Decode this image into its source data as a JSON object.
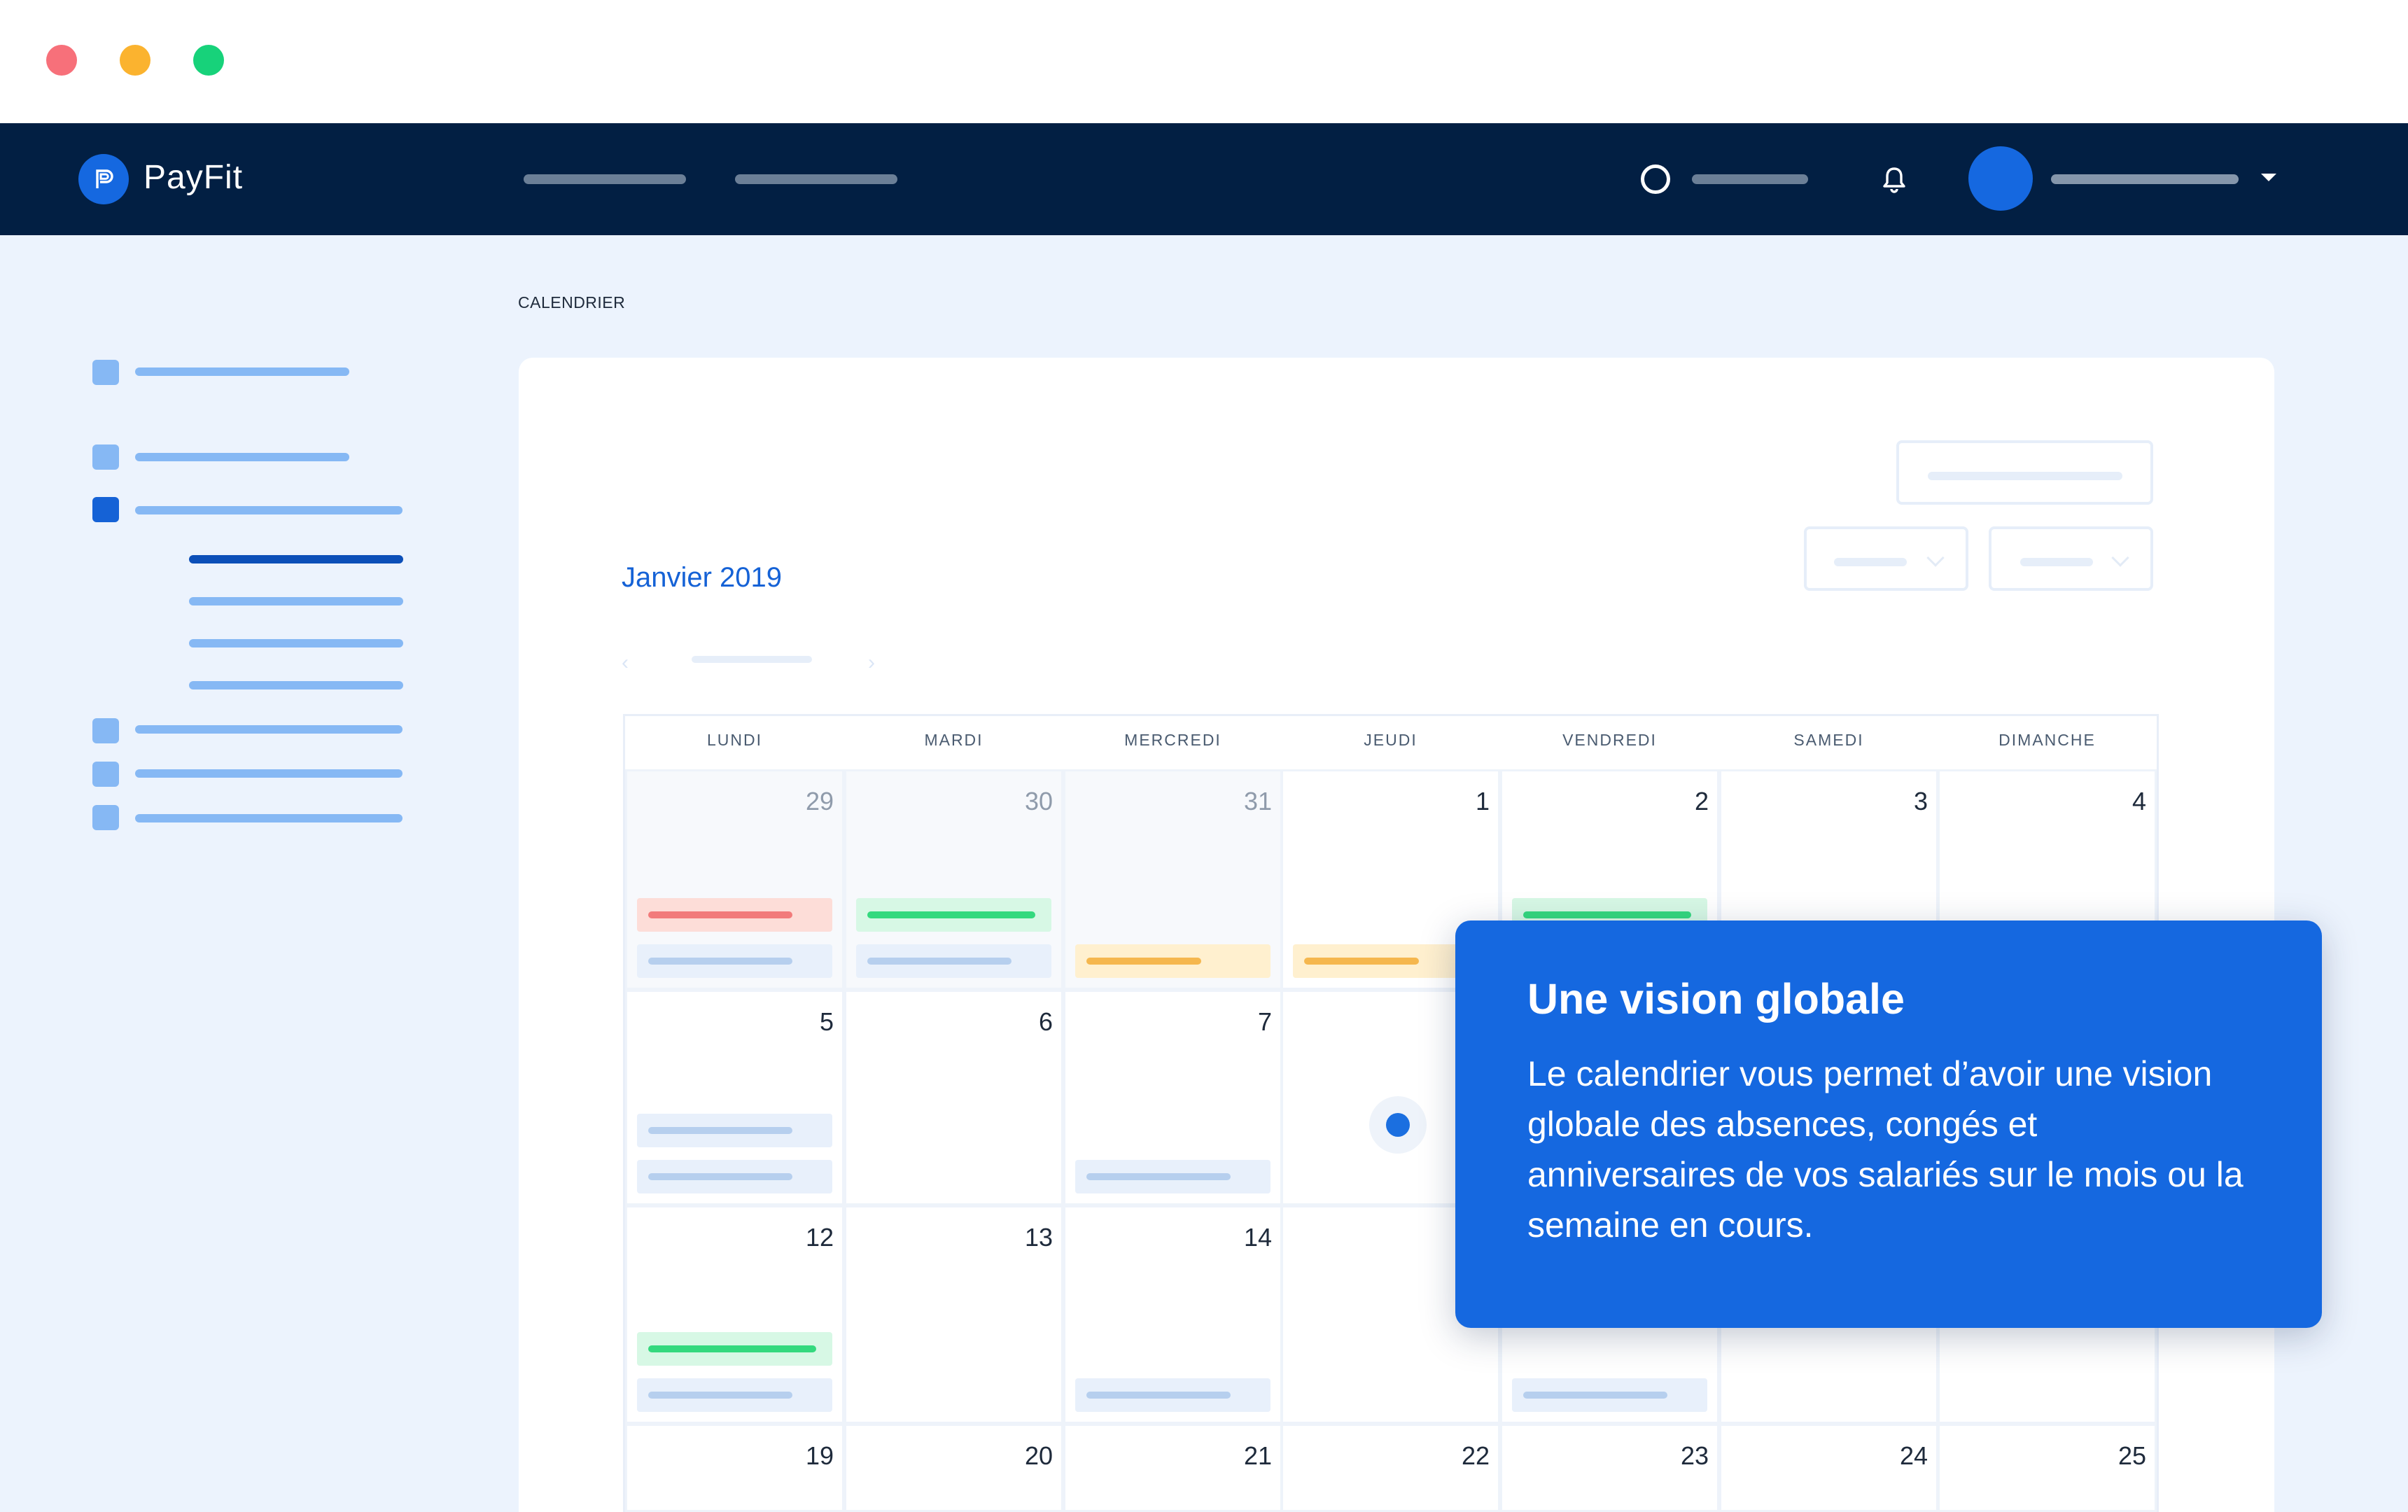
{
  "app": {
    "name": "PayFit",
    "colors": {
      "brand": "#1568e0",
      "nav_background": "#021f43",
      "page_background": "#ecf3fd"
    }
  },
  "window_controls": [
    {
      "name": "close",
      "color": "#f7707a"
    },
    {
      "name": "minimize",
      "color": "#fbb32f"
    },
    {
      "name": "maximize",
      "color": "#17d27a"
    }
  ],
  "breadcrumb": "CALENDRIER",
  "calendar": {
    "month_label": "Janvier 2019",
    "prev_icon": "chevron-left-icon",
    "next_icon": "chevron-right-icon",
    "weekdays": [
      "LUNDI",
      "MARDI",
      "MERCREDI",
      "JEUDI",
      "VENDREDI",
      "SAMEDI",
      "DIMANCHE"
    ],
    "weeks": [
      [
        {
          "day": "29",
          "outside_month": true,
          "events": [
            "red",
            "blue"
          ]
        },
        {
          "day": "30",
          "outside_month": true,
          "events": [
            "green",
            "blue"
          ]
        },
        {
          "day": "31",
          "outside_month": true,
          "events": [
            "yellow"
          ]
        },
        {
          "day": "1",
          "outside_month": false,
          "events": [
            "yellow"
          ]
        },
        {
          "day": "2",
          "outside_month": false,
          "events": [
            "green",
            "blue"
          ]
        },
        {
          "day": "3",
          "outside_month": false,
          "events": []
        },
        {
          "day": "4",
          "outside_month": false,
          "events": []
        }
      ],
      [
        {
          "day": "5",
          "outside_month": false,
          "events": [
            "blue",
            "blue"
          ]
        },
        {
          "day": "6",
          "outside_month": false,
          "events": []
        },
        {
          "day": "7",
          "outside_month": false,
          "events": [
            "blue"
          ]
        },
        {
          "day": "",
          "outside_month": false,
          "events": []
        },
        {
          "day": "",
          "outside_month": false,
          "events": []
        },
        {
          "day": "",
          "outside_month": false,
          "events": []
        },
        {
          "day": "",
          "outside_month": false,
          "events": []
        }
      ],
      [
        {
          "day": "12",
          "outside_month": false,
          "events": [
            "green",
            "blue"
          ]
        },
        {
          "day": "13",
          "outside_month": false,
          "events": []
        },
        {
          "day": "14",
          "outside_month": false,
          "events": [
            "blue"
          ]
        },
        {
          "day": "",
          "outside_month": false,
          "events": []
        },
        {
          "day": "",
          "outside_month": false,
          "events": [
            "blue"
          ]
        },
        {
          "day": "",
          "outside_month": false,
          "events": []
        },
        {
          "day": "",
          "outside_month": false,
          "events": []
        }
      ],
      [
        {
          "day": "19",
          "outside_month": false,
          "events": []
        },
        {
          "day": "20",
          "outside_month": false,
          "events": []
        },
        {
          "day": "21",
          "outside_month": false,
          "events": []
        },
        {
          "day": "22",
          "outside_month": false,
          "events": []
        },
        {
          "day": "23",
          "outside_month": false,
          "events": []
        },
        {
          "day": "24",
          "outside_month": false,
          "events": []
        },
        {
          "day": "25",
          "outside_month": false,
          "events": []
        }
      ]
    ],
    "event_colors": {
      "red": "#fdddd8",
      "green": "#d7f8e5",
      "blue": "#e8f0fb",
      "yellow": "#fff0cf"
    }
  },
  "tooltip": {
    "title": "Une vision globale",
    "body": "Le calendrier vous permet d’avoir une vision globale des absences, congés et anniversaires de vos salariés sur le mois ou la semaine en cours."
  }
}
